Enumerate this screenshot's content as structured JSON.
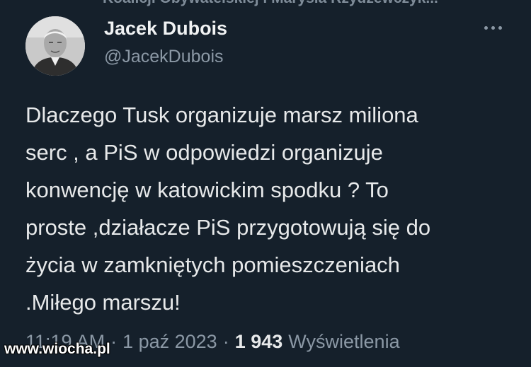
{
  "header_cut_text": "Koalicji Obywatelskiej i Marysia Rzydzewczyk...",
  "tweet": {
    "author_name": "Jacek Dubois",
    "author_handle": "@JacekDubois",
    "lines": [
      "Dlaczego Tusk organizuje marsz miliona",
      "serc , a PiS w odpowiedzi organizuje",
      "konwencję w katowickim spodku ? To",
      "proste ,działacze PiS przygotowują się do",
      "życia w zamkniętych pomieszczeniach",
      ".Miłego marszu!"
    ],
    "time": "11:19 AM",
    "date": "1 paź 2023",
    "separator": "·",
    "views_count": "1 943",
    "views_label": "Wyświetlenia"
  },
  "watermark": "www.wiocha.pl",
  "icons": {
    "more": "more-horizontal-icon"
  },
  "colors": {
    "background": "#15202b",
    "text_primary": "#e7e9ea",
    "text_secondary": "#8b98a5"
  }
}
